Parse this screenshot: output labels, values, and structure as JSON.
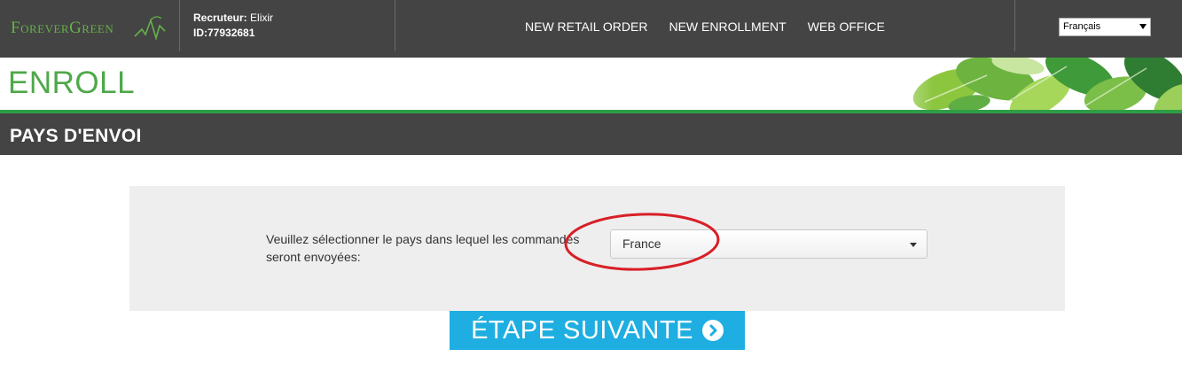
{
  "header": {
    "logo_text": "ForeverGreen",
    "recruiter_label": "Recruteur:",
    "recruiter_name": "Elixir",
    "recruiter_id": "ID:77932681",
    "nav": [
      {
        "label": "NEW RETAIL ORDER"
      },
      {
        "label": "NEW ENROLLMENT"
      },
      {
        "label": "WEB OFFICE"
      }
    ],
    "language": {
      "selected": "Français"
    }
  },
  "banner": {
    "title": "ENROLL"
  },
  "section": {
    "title": "PAYS D'ENVOI"
  },
  "form": {
    "prompt": "Veuillez sélectionner le pays dans lequel les commandes seront envoyées:",
    "country_selected": "France"
  },
  "next_button": {
    "label": "ÉTAPE SUIVANTE"
  },
  "colors": {
    "header_bg": "#444444",
    "brand_green": "#4fa84a",
    "button_blue": "#1eaee1",
    "annotation_red": "#d81f26"
  },
  "icons": {
    "logo_mark": "leaf-peak-icon",
    "next": "chevron-right-circle-icon",
    "dropdown": "caret-down-icon"
  }
}
